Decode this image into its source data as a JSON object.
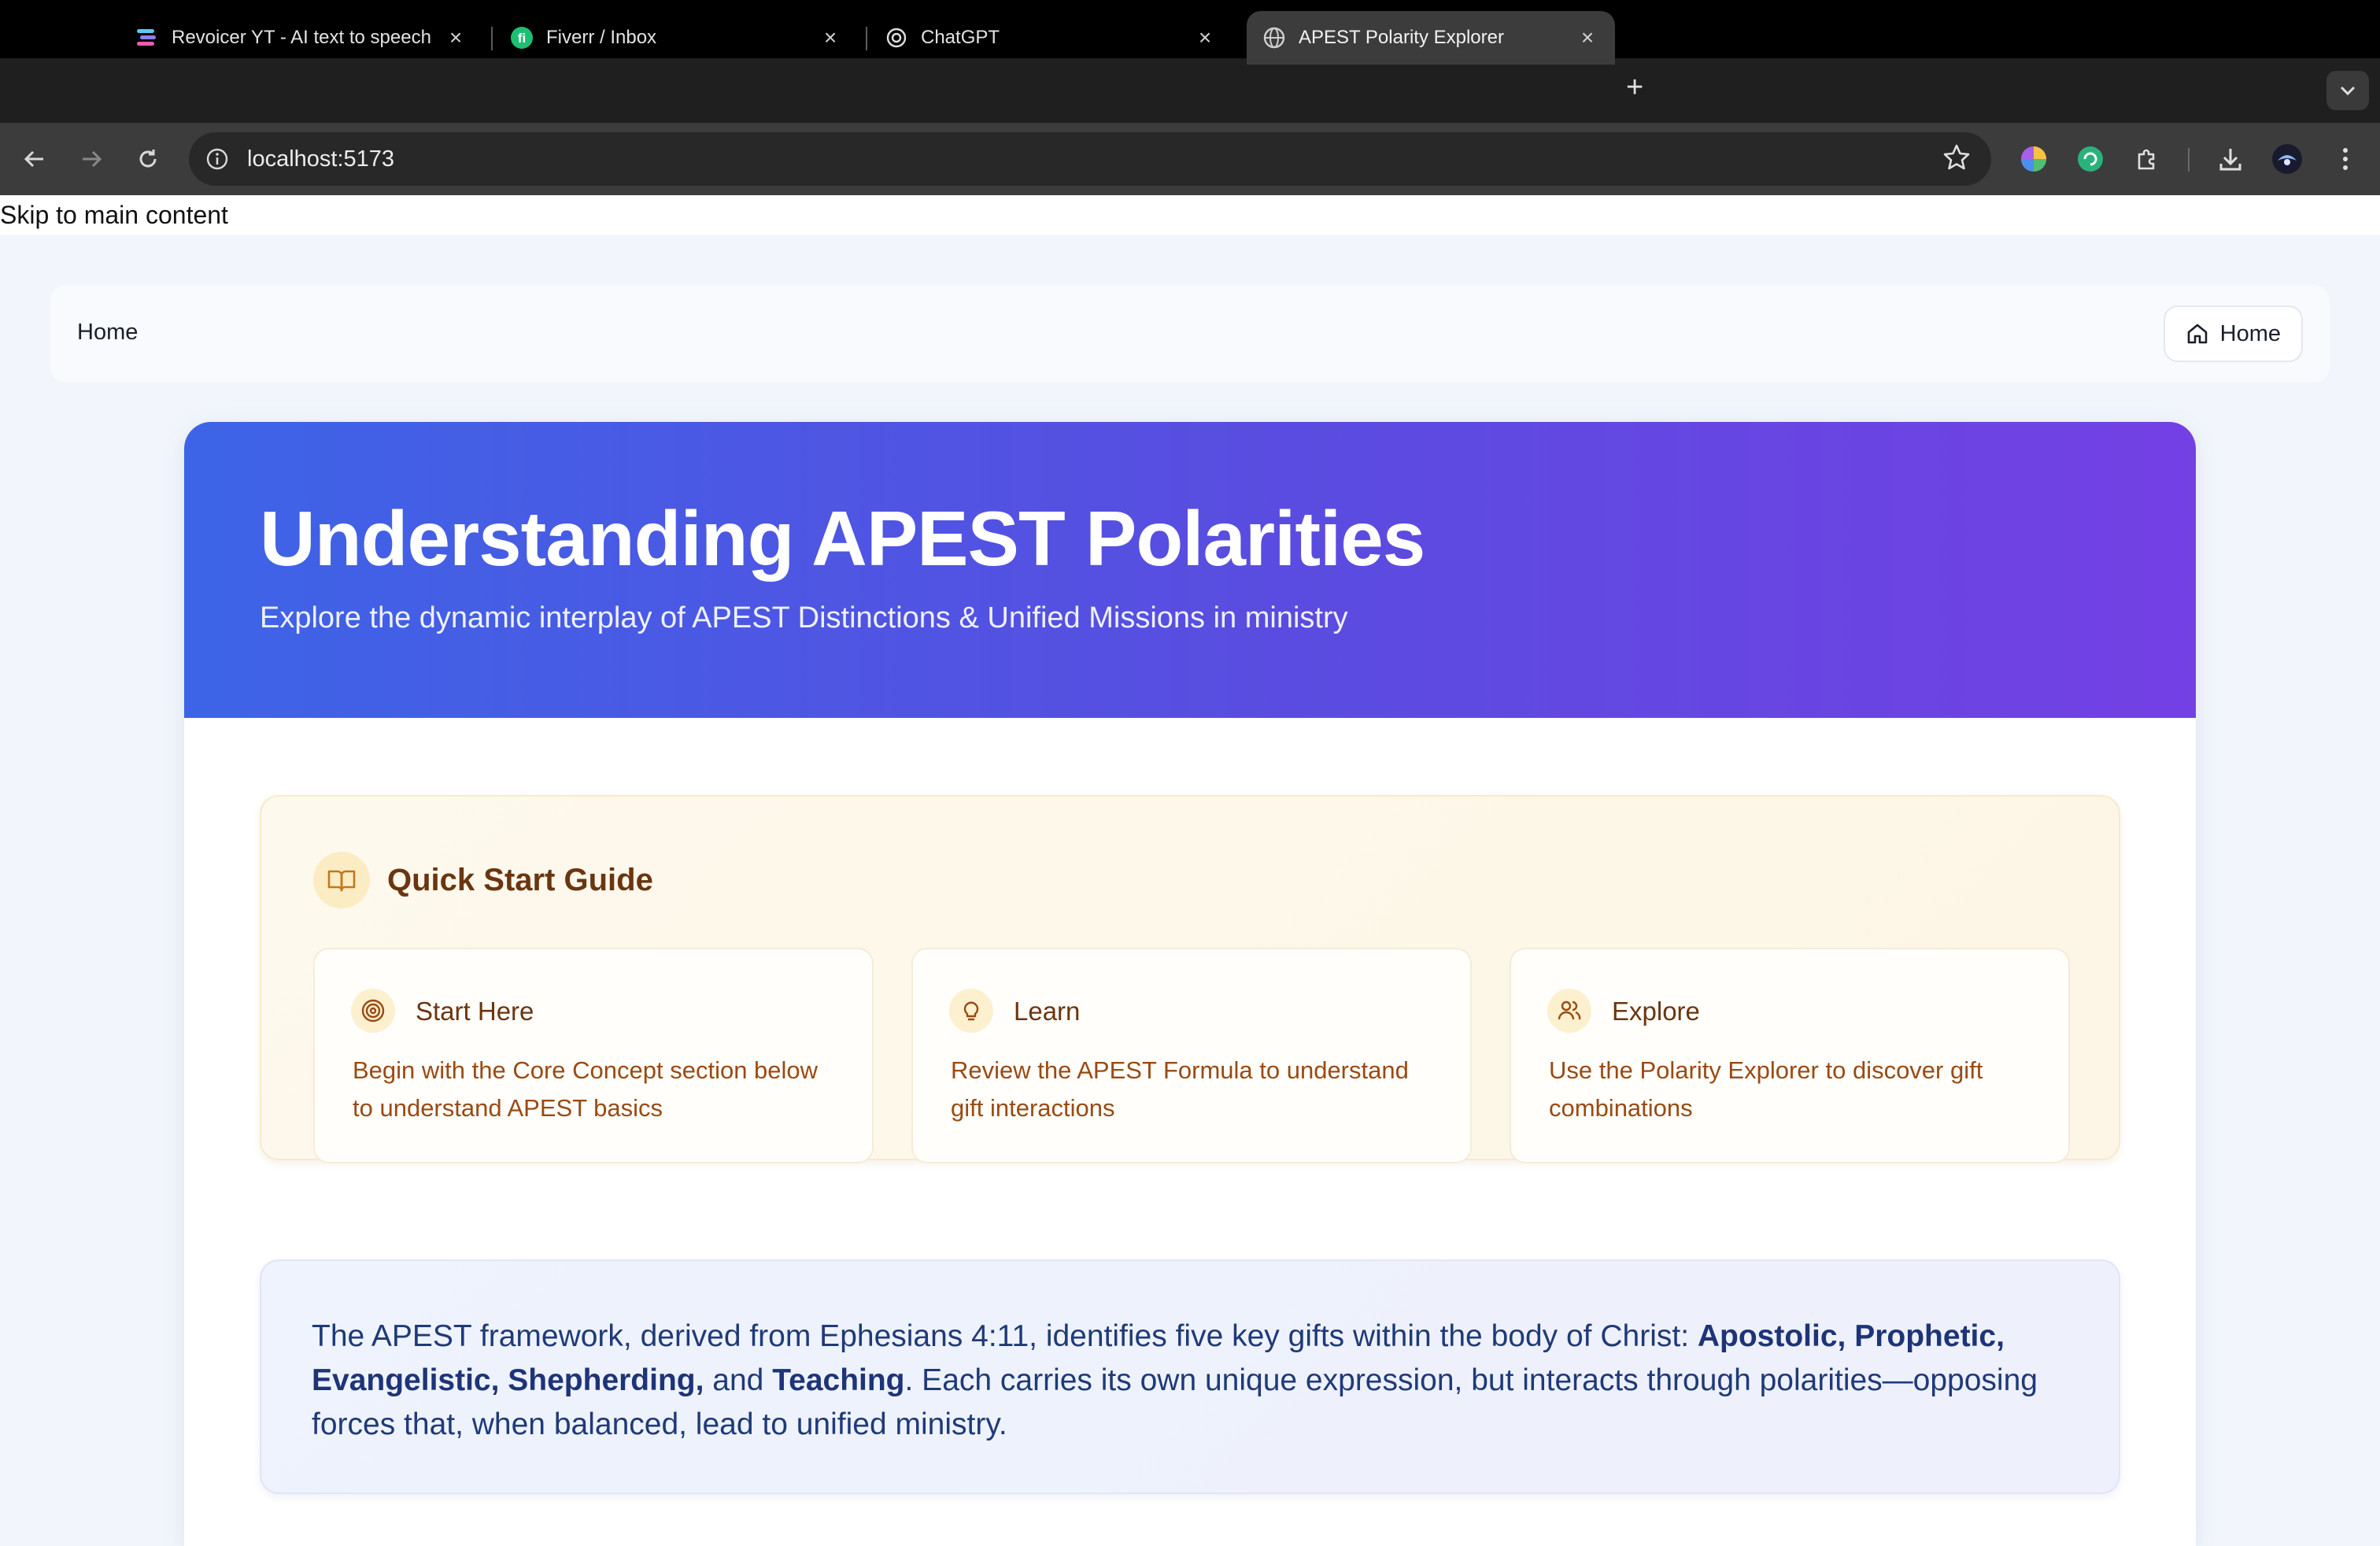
{
  "browser": {
    "tabs": [
      {
        "title": "Revoicer YT - AI text to speech",
        "favicon": "revoicer-icon"
      },
      {
        "title": "Fiverr / Inbox",
        "favicon": "fiverr-icon"
      },
      {
        "title": "ChatGPT",
        "favicon": "chatgpt-icon"
      },
      {
        "title": "APEST Polarity Explorer",
        "favicon": "globe-icon",
        "active": true
      }
    ],
    "new_tab": "+",
    "url": "localhost:5173"
  },
  "skip_link": "Skip to main content",
  "topnav": {
    "brand": "Home",
    "home_button": "Home"
  },
  "hero": {
    "title": "Understanding APEST Polarities",
    "subtitle": "Explore the dynamic interplay of APEST Distinctions & Unified Missions in ministry"
  },
  "quick_start": {
    "title": "Quick Start Guide",
    "cards": [
      {
        "icon": "target-icon",
        "title": "Start Here",
        "description": "Begin with the Core Concept section below to understand APEST basics"
      },
      {
        "icon": "lightbulb-icon",
        "title": "Learn",
        "description": "Review the APEST Formula to understand gift interactions"
      },
      {
        "icon": "users-icon",
        "title": "Explore",
        "description": "Use the Polarity Explorer to discover gift combinations"
      }
    ]
  },
  "intro": {
    "p1": "The APEST framework, derived from Ephesians 4:11, identifies five key gifts within the body of Christ: ",
    "bold1": "Apostolic, Prophetic, Evangelistic, Shepherding,",
    "p2": " and ",
    "bold2": "Teaching",
    "p3": ". Each carries its own unique expression, but interacts through polarities—opposing forces that, when balanced, lead to unified ministry."
  },
  "colors": {
    "hero_gradient_start": "#3d64e6",
    "hero_gradient_end": "#7340e4",
    "quick_start_text": "#6b3510",
    "intro_text": "#1f3a78"
  }
}
